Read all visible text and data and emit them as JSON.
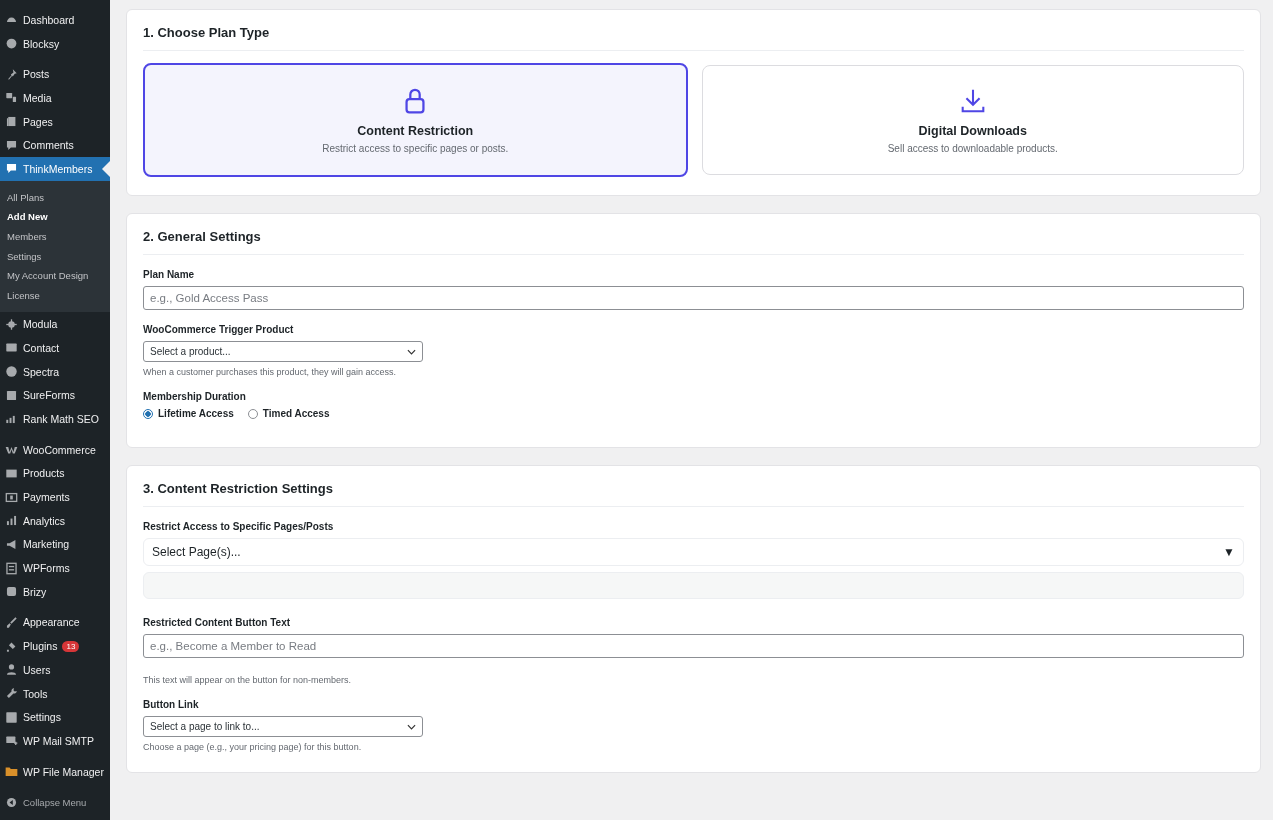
{
  "sidebar": {
    "groups": [
      [
        {
          "label": "Dashboard",
          "selected": false
        },
        {
          "label": "Blocksy",
          "selected": false
        }
      ],
      [
        {
          "label": "Posts",
          "selected": false
        },
        {
          "label": "Media",
          "selected": false
        },
        {
          "label": "Pages",
          "selected": false
        },
        {
          "label": "Comments",
          "selected": false
        },
        {
          "label": "ThinkMembers",
          "selected": true,
          "children": [
            {
              "label": "All Plans",
              "selected": false
            },
            {
              "label": "Add New",
              "selected": true
            },
            {
              "label": "Members",
              "selected": false
            },
            {
              "label": "Settings",
              "selected": false
            },
            {
              "label": "My Account Design",
              "selected": false
            },
            {
              "label": "License",
              "selected": false
            }
          ]
        },
        {
          "label": "Modula",
          "selected": false
        },
        {
          "label": "Contact",
          "selected": false
        },
        {
          "label": "Spectra",
          "selected": false
        },
        {
          "label": "SureForms",
          "selected": false
        },
        {
          "label": "Rank Math SEO",
          "selected": false
        }
      ],
      [
        {
          "label": "WooCommerce",
          "selected": false
        },
        {
          "label": "Products",
          "selected": false
        },
        {
          "label": "Payments",
          "selected": false
        },
        {
          "label": "Analytics",
          "selected": false
        },
        {
          "label": "Marketing",
          "selected": false
        },
        {
          "label": "WPForms",
          "selected": false
        },
        {
          "label": "Brizy",
          "selected": false
        }
      ],
      [
        {
          "label": "Appearance",
          "selected": false
        },
        {
          "label": "Plugins",
          "selected": false,
          "badge": "13"
        },
        {
          "label": "Users",
          "selected": false
        },
        {
          "label": "Tools",
          "selected": false
        },
        {
          "label": "Settings",
          "selected": false
        },
        {
          "label": "WP Mail SMTP",
          "selected": false
        }
      ],
      [
        {
          "label": "WP File Manager",
          "selected": false
        }
      ]
    ],
    "collapse": "Collapse Menu"
  },
  "plan_type": {
    "title": "1. Choose Plan Type",
    "options": [
      {
        "title": "Content Restriction",
        "description": "Restrict access to specific pages or posts.",
        "selected": true
      },
      {
        "title": "Digital Downloads",
        "description": "Sell access to downloadable products.",
        "selected": false
      }
    ]
  },
  "general": {
    "title": "2. General Settings",
    "plan_name": {
      "label": "Plan Name",
      "placeholder": "e.g., Gold Access Pass"
    },
    "trigger_product": {
      "label": "WooCommerce Trigger Product",
      "value": "Select a product...",
      "help": "When a customer purchases this product, they will gain access."
    },
    "duration": {
      "label": "Membership Duration",
      "options": [
        {
          "label": "Lifetime Access",
          "selected": true
        },
        {
          "label": "Timed Access",
          "selected": false
        }
      ]
    }
  },
  "restriction": {
    "title": "3. Content Restriction Settings",
    "pages": {
      "label": "Restrict Access to Specific Pages/Posts",
      "value": "Select Page(s)...",
      "arrow": "▼"
    },
    "button_text": {
      "label": "Restricted Content Button Text",
      "placeholder": "e.g., Become a Member to Read",
      "help": "This text will appear on the button for non-members."
    },
    "button_link": {
      "label": "Button Link",
      "value": "Select a page to link to...",
      "help": "Choose a page (e.g., your pricing page) for this button."
    }
  }
}
